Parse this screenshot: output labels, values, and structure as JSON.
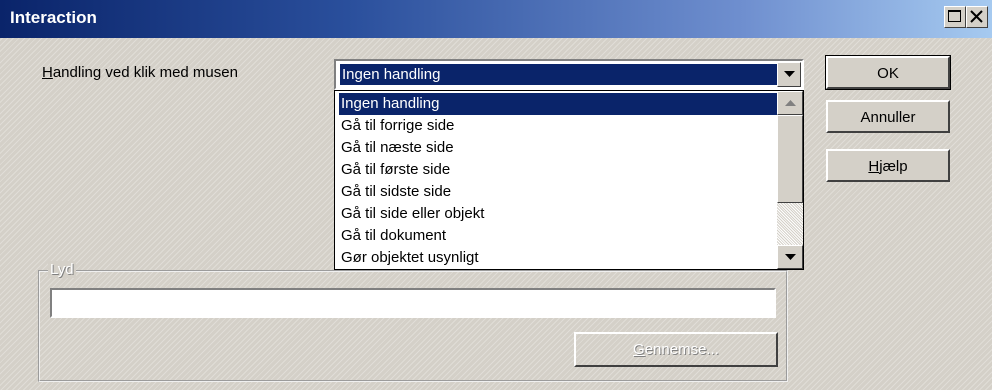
{
  "window": {
    "title": "Interaction"
  },
  "action": {
    "label_first": "H",
    "label_rest": "andling ved klik med musen",
    "selected": "Ingen handling",
    "options": [
      "Ingen handling",
      "Gå til forrige side",
      "Gå til næste side",
      "Gå til første side",
      "Gå til sidste side",
      "Gå til side eller objekt",
      "Gå til dokument",
      "Gør objektet usynligt"
    ]
  },
  "buttons": {
    "ok": "OK",
    "cancel": "Annuller",
    "help_first": "H",
    "help_rest": "jælp"
  },
  "sound": {
    "group_label": "Lyd",
    "value": "",
    "browse_first": "G",
    "browse_rest": "ennemse..."
  },
  "icons": {
    "maximize": "maximize-icon",
    "close": "close-icon",
    "dropdown": "chevron-down-icon",
    "scroll_up": "arrow-up-icon",
    "scroll_down": "arrow-down-icon"
  },
  "colors": {
    "titlebar": "#0a246a",
    "selection": "#0a246a",
    "face": "#d4d0c8"
  }
}
